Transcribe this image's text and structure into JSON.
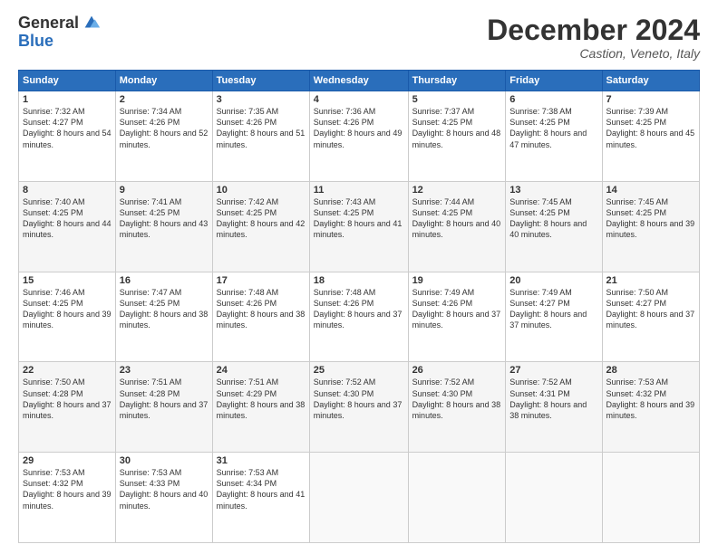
{
  "logo": {
    "general": "General",
    "blue": "Blue"
  },
  "header": {
    "month": "December 2024",
    "location": "Castion, Veneto, Italy"
  },
  "weekdays": [
    "Sunday",
    "Monday",
    "Tuesday",
    "Wednesday",
    "Thursday",
    "Friday",
    "Saturday"
  ],
  "weeks": [
    [
      {
        "day": "1",
        "sunrise": "Sunrise: 7:32 AM",
        "sunset": "Sunset: 4:27 PM",
        "daylight": "Daylight: 8 hours and 54 minutes."
      },
      {
        "day": "2",
        "sunrise": "Sunrise: 7:34 AM",
        "sunset": "Sunset: 4:26 PM",
        "daylight": "Daylight: 8 hours and 52 minutes."
      },
      {
        "day": "3",
        "sunrise": "Sunrise: 7:35 AM",
        "sunset": "Sunset: 4:26 PM",
        "daylight": "Daylight: 8 hours and 51 minutes."
      },
      {
        "day": "4",
        "sunrise": "Sunrise: 7:36 AM",
        "sunset": "Sunset: 4:26 PM",
        "daylight": "Daylight: 8 hours and 49 minutes."
      },
      {
        "day": "5",
        "sunrise": "Sunrise: 7:37 AM",
        "sunset": "Sunset: 4:25 PM",
        "daylight": "Daylight: 8 hours and 48 minutes."
      },
      {
        "day": "6",
        "sunrise": "Sunrise: 7:38 AM",
        "sunset": "Sunset: 4:25 PM",
        "daylight": "Daylight: 8 hours and 47 minutes."
      },
      {
        "day": "7",
        "sunrise": "Sunrise: 7:39 AM",
        "sunset": "Sunset: 4:25 PM",
        "daylight": "Daylight: 8 hours and 45 minutes."
      }
    ],
    [
      {
        "day": "8",
        "sunrise": "Sunrise: 7:40 AM",
        "sunset": "Sunset: 4:25 PM",
        "daylight": "Daylight: 8 hours and 44 minutes."
      },
      {
        "day": "9",
        "sunrise": "Sunrise: 7:41 AM",
        "sunset": "Sunset: 4:25 PM",
        "daylight": "Daylight: 8 hours and 43 minutes."
      },
      {
        "day": "10",
        "sunrise": "Sunrise: 7:42 AM",
        "sunset": "Sunset: 4:25 PM",
        "daylight": "Daylight: 8 hours and 42 minutes."
      },
      {
        "day": "11",
        "sunrise": "Sunrise: 7:43 AM",
        "sunset": "Sunset: 4:25 PM",
        "daylight": "Daylight: 8 hours and 41 minutes."
      },
      {
        "day": "12",
        "sunrise": "Sunrise: 7:44 AM",
        "sunset": "Sunset: 4:25 PM",
        "daylight": "Daylight: 8 hours and 40 minutes."
      },
      {
        "day": "13",
        "sunrise": "Sunrise: 7:45 AM",
        "sunset": "Sunset: 4:25 PM",
        "daylight": "Daylight: 8 hours and 40 minutes."
      },
      {
        "day": "14",
        "sunrise": "Sunrise: 7:45 AM",
        "sunset": "Sunset: 4:25 PM",
        "daylight": "Daylight: 8 hours and 39 minutes."
      }
    ],
    [
      {
        "day": "15",
        "sunrise": "Sunrise: 7:46 AM",
        "sunset": "Sunset: 4:25 PM",
        "daylight": "Daylight: 8 hours and 39 minutes."
      },
      {
        "day": "16",
        "sunrise": "Sunrise: 7:47 AM",
        "sunset": "Sunset: 4:25 PM",
        "daylight": "Daylight: 8 hours and 38 minutes."
      },
      {
        "day": "17",
        "sunrise": "Sunrise: 7:48 AM",
        "sunset": "Sunset: 4:26 PM",
        "daylight": "Daylight: 8 hours and 38 minutes."
      },
      {
        "day": "18",
        "sunrise": "Sunrise: 7:48 AM",
        "sunset": "Sunset: 4:26 PM",
        "daylight": "Daylight: 8 hours and 37 minutes."
      },
      {
        "day": "19",
        "sunrise": "Sunrise: 7:49 AM",
        "sunset": "Sunset: 4:26 PM",
        "daylight": "Daylight: 8 hours and 37 minutes."
      },
      {
        "day": "20",
        "sunrise": "Sunrise: 7:49 AM",
        "sunset": "Sunset: 4:27 PM",
        "daylight": "Daylight: 8 hours and 37 minutes."
      },
      {
        "day": "21",
        "sunrise": "Sunrise: 7:50 AM",
        "sunset": "Sunset: 4:27 PM",
        "daylight": "Daylight: 8 hours and 37 minutes."
      }
    ],
    [
      {
        "day": "22",
        "sunrise": "Sunrise: 7:50 AM",
        "sunset": "Sunset: 4:28 PM",
        "daylight": "Daylight: 8 hours and 37 minutes."
      },
      {
        "day": "23",
        "sunrise": "Sunrise: 7:51 AM",
        "sunset": "Sunset: 4:28 PM",
        "daylight": "Daylight: 8 hours and 37 minutes."
      },
      {
        "day": "24",
        "sunrise": "Sunrise: 7:51 AM",
        "sunset": "Sunset: 4:29 PM",
        "daylight": "Daylight: 8 hours and 38 minutes."
      },
      {
        "day": "25",
        "sunrise": "Sunrise: 7:52 AM",
        "sunset": "Sunset: 4:30 PM",
        "daylight": "Daylight: 8 hours and 37 minutes."
      },
      {
        "day": "26",
        "sunrise": "Sunrise: 7:52 AM",
        "sunset": "Sunset: 4:30 PM",
        "daylight": "Daylight: 8 hours and 38 minutes."
      },
      {
        "day": "27",
        "sunrise": "Sunrise: 7:52 AM",
        "sunset": "Sunset: 4:31 PM",
        "daylight": "Daylight: 8 hours and 38 minutes."
      },
      {
        "day": "28",
        "sunrise": "Sunrise: 7:53 AM",
        "sunset": "Sunset: 4:32 PM",
        "daylight": "Daylight: 8 hours and 39 minutes."
      }
    ],
    [
      {
        "day": "29",
        "sunrise": "Sunrise: 7:53 AM",
        "sunset": "Sunset: 4:32 PM",
        "daylight": "Daylight: 8 hours and 39 minutes."
      },
      {
        "day": "30",
        "sunrise": "Sunrise: 7:53 AM",
        "sunset": "Sunset: 4:33 PM",
        "daylight": "Daylight: 8 hours and 40 minutes."
      },
      {
        "day": "31",
        "sunrise": "Sunrise: 7:53 AM",
        "sunset": "Sunset: 4:34 PM",
        "daylight": "Daylight: 8 hours and 41 minutes."
      },
      null,
      null,
      null,
      null
    ]
  ]
}
